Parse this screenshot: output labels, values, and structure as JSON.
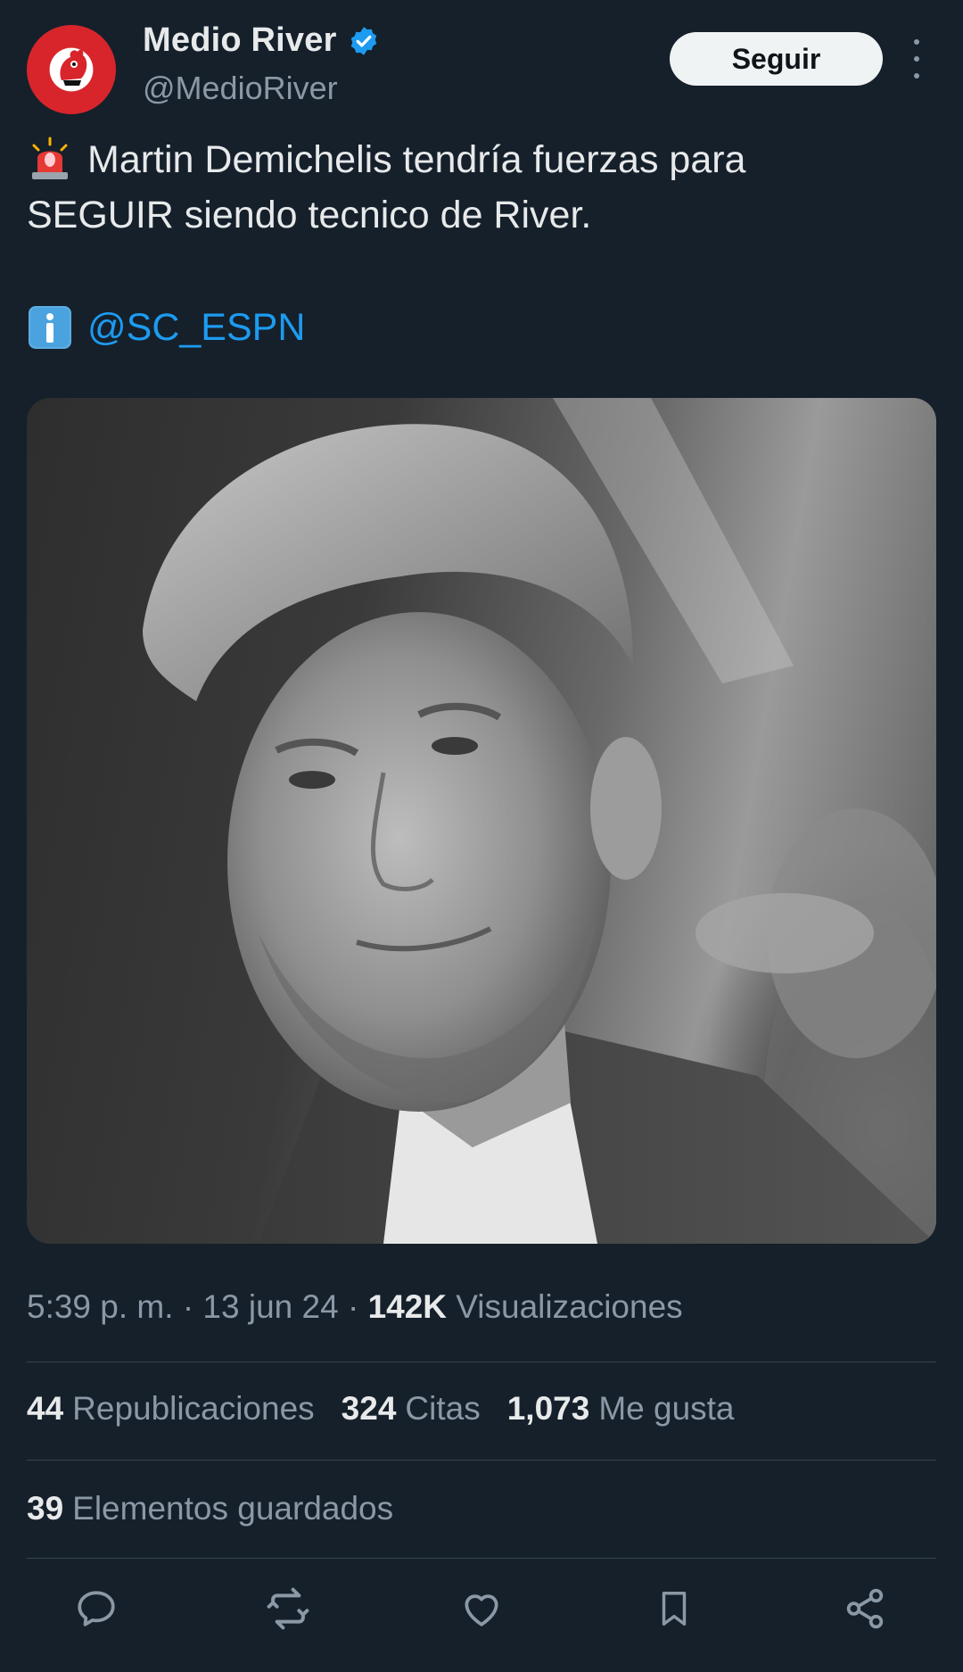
{
  "author": {
    "display_name": "Medio River",
    "handle": "@MedioRiver",
    "verified": true
  },
  "follow_button": {
    "label": "Seguir"
  },
  "tweet": {
    "line1": "Martin Demichelis tendría fuerzas para",
    "line2": "SEGUIR siendo tecnico de River.",
    "mention": "@SC_ESPN",
    "emoji_siren": "siren-emoji",
    "emoji_info": "info-emoji"
  },
  "meta": {
    "time": "5:39 p. m.",
    "sep1": "·",
    "date": "13 jun 24",
    "sep2": "·",
    "views_count": "142K",
    "views_label": "Visualizaciones"
  },
  "stats": {
    "reposts_count": "44",
    "reposts_label": "Republicaciones",
    "quotes_count": "324",
    "quotes_label": "Citas",
    "likes_count": "1,073",
    "likes_label": "Me gusta"
  },
  "bookmarks": {
    "count": "39",
    "label": "Elementos guardados"
  },
  "colors": {
    "background": "#15202b",
    "accent": "#1d9bf0",
    "text_primary": "#e7e9ea",
    "text_secondary": "#8b98a5",
    "divider": "#38444d",
    "avatar_red": "#d7252b"
  },
  "icons": {
    "reply": "reply-icon",
    "repost": "repost-icon",
    "like": "like-icon",
    "bookmark": "bookmark-icon",
    "share": "share-icon",
    "more": "more-icon"
  }
}
